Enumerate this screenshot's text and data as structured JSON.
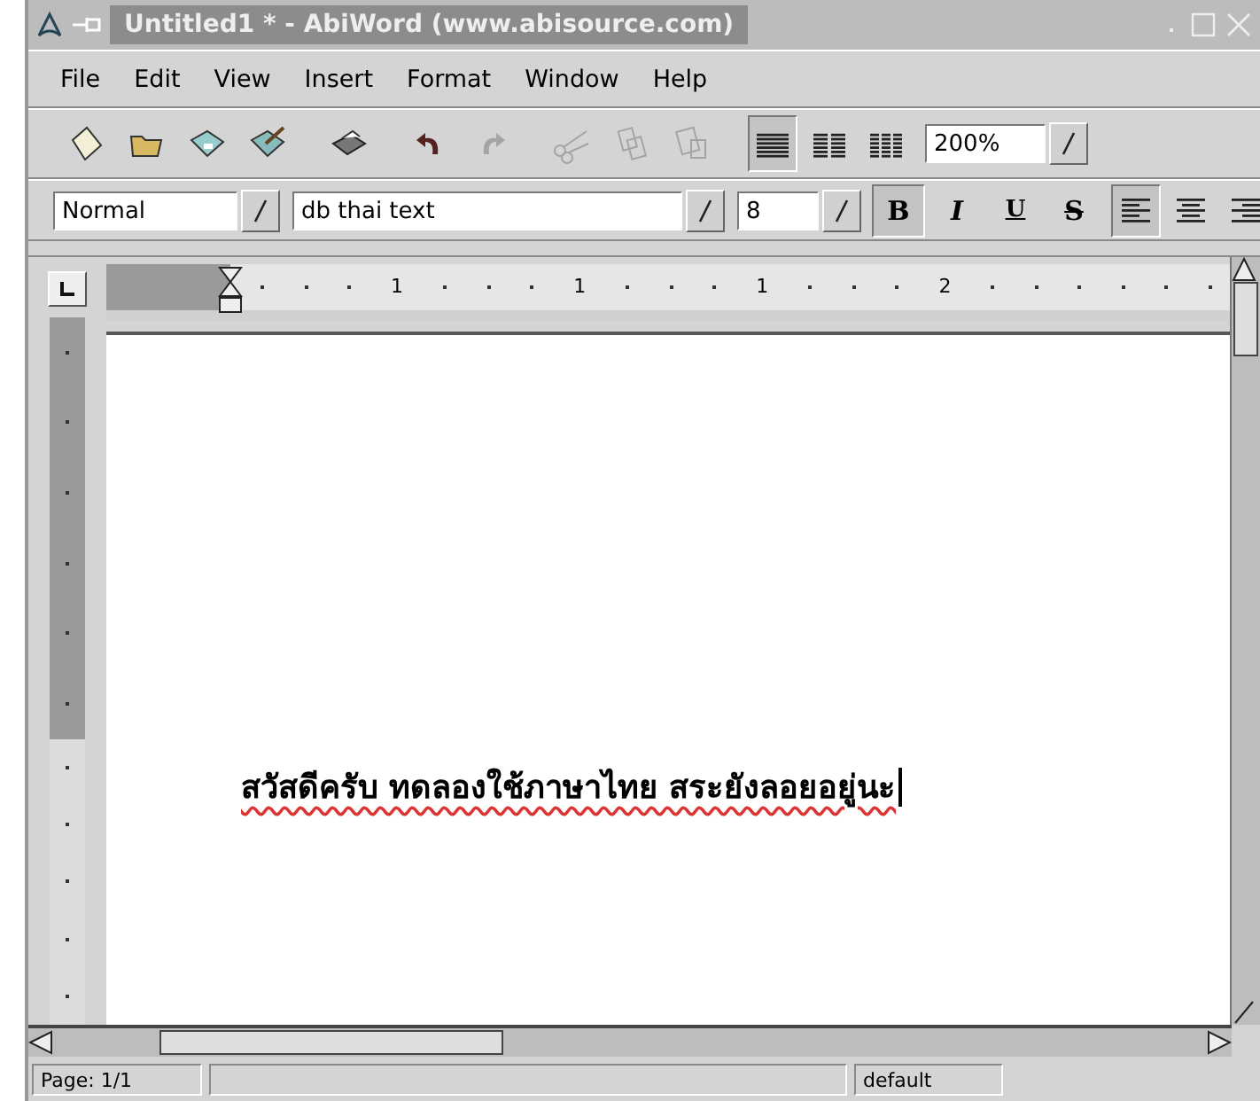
{
  "window": {
    "title": "Untitled1 * - AbiWord (www.abisource.com)"
  },
  "menu": [
    "File",
    "Edit",
    "View",
    "Insert",
    "Format",
    "Window",
    "Help"
  ],
  "toolbar": {
    "buttons": [
      {
        "kind": "new",
        "disabled": false
      },
      {
        "kind": "open",
        "disabled": false
      },
      {
        "kind": "save",
        "disabled": false
      },
      {
        "kind": "saveas",
        "disabled": false
      },
      {
        "kind": "print",
        "disabled": false
      },
      {
        "kind": "undo",
        "disabled": false
      },
      {
        "kind": "redo",
        "disabled": true
      },
      {
        "kind": "cut",
        "disabled": true
      },
      {
        "kind": "copy",
        "disabled": true
      },
      {
        "kind": "paste",
        "disabled": true
      }
    ],
    "views": [
      {
        "kind": "normal",
        "selected": true
      },
      {
        "kind": "web",
        "selected": false
      },
      {
        "kind": "print",
        "selected": false
      }
    ],
    "zoom": "200%"
  },
  "format_bar": {
    "style": "Normal",
    "font": "db thai text",
    "size": "8",
    "text_buttons": [
      {
        "label": "B",
        "kind": "bold",
        "selected": true
      },
      {
        "label": "I",
        "kind": "italic",
        "selected": false
      },
      {
        "label": "U",
        "kind": "underline",
        "selected": false
      },
      {
        "label": "S",
        "kind": "strike",
        "selected": false
      }
    ],
    "align": [
      {
        "kind": "left",
        "selected": true
      },
      {
        "kind": "center",
        "selected": false
      },
      {
        "kind": "right",
        "selected": false
      }
    ]
  },
  "ruler": {
    "labels": [
      "1",
      "1",
      "1",
      "2"
    ]
  },
  "document": {
    "text": "สวัสดีครับ ทดลองใช้ภาษาไทย สระยังลอยอยู่นะ"
  },
  "status_bar": {
    "page": "Page: 1/1",
    "mode": "default"
  }
}
